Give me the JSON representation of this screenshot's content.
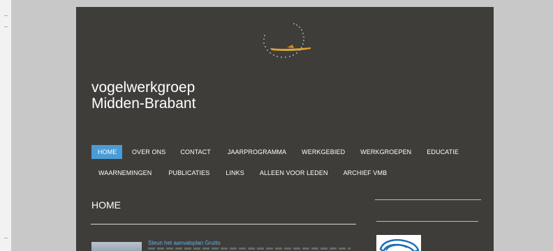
{
  "site": {
    "title_line1": "vogelwerkgroep",
    "title_line2": "Midden-Brabant"
  },
  "nav": {
    "row1": [
      {
        "label": "HOME",
        "active": true
      },
      {
        "label": "OVER ONS"
      },
      {
        "label": "CONTACT"
      },
      {
        "label": "JAARPROGRAMMA"
      },
      {
        "label": "WERKGEBIED"
      },
      {
        "label": "WERKGROEPEN"
      },
      {
        "label": "EDUCATIE"
      }
    ],
    "row2": [
      {
        "label": "WAARNEMINGEN"
      },
      {
        "label": "PUBLICATIES"
      },
      {
        "label": "LINKS"
      },
      {
        "label": "ALLEEN VOOR LEDEN"
      },
      {
        "label": "ARCHIEF VMB"
      }
    ]
  },
  "main": {
    "section_title": "HOME",
    "post": {
      "title": "Steun het aanvalsplan Grutto"
    }
  },
  "colors": {
    "page_bg": "#3e3d3a",
    "accent": "#4b9bd6",
    "link": "#6aaee8",
    "logo_bird": "#e0a434",
    "logo_dots": "#a9d4e6"
  },
  "icons": {
    "logo": "bird-logo-icon",
    "sidebar_image": "sidebar-logo-image"
  }
}
